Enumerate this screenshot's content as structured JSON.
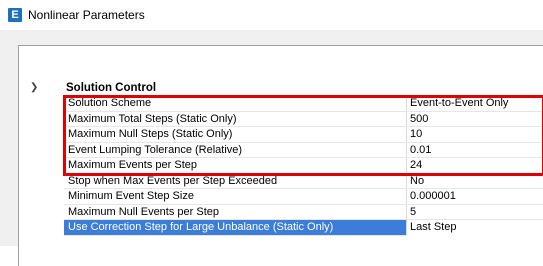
{
  "window": {
    "title": "Nonlinear Parameters",
    "icon_letter": "E",
    "icon_color": "#1f6fbf"
  },
  "section": {
    "title": "Solution Control",
    "expanded": true
  },
  "rows": [
    {
      "name": "Solution Scheme",
      "value": "Event-to-Event Only"
    },
    {
      "name": "Maximum Total Steps (Static Only)",
      "value": "500"
    },
    {
      "name": "Maximum Null Steps (Static Only)",
      "value": "10"
    },
    {
      "name": "Event Lumping Tolerance (Relative)",
      "value": "0.01"
    },
    {
      "name": "Maximum Events per Step",
      "value": "24"
    },
    {
      "name": "Stop when Max Events per Step Exceeded",
      "value": "No"
    },
    {
      "name": "Minimum Event Step Size",
      "value": "0.000001"
    },
    {
      "name": "Maximum Null Events per Step",
      "value": "5"
    },
    {
      "name": "Use Correction Step for Large Unbalance (Static Only)",
      "value": "Last Step"
    }
  ],
  "colors": {
    "highlight_border": "#e00000",
    "selection": "#3b7dd8"
  }
}
